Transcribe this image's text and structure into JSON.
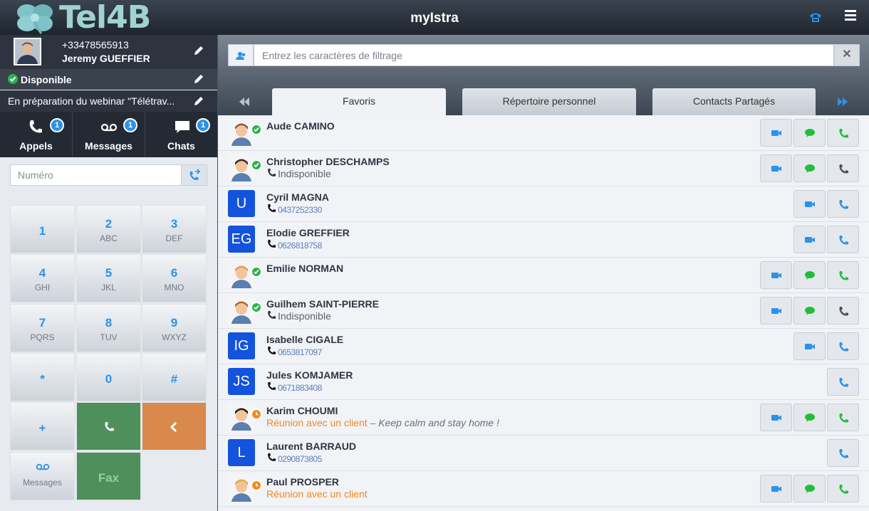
{
  "app": {
    "brand": "Tel4B",
    "title": "myIstra"
  },
  "user": {
    "number": "+33478565913",
    "name": "Jeremy GUEFFIER",
    "status": "Disponible",
    "message": "En préparation du webinar \"Télétrav..."
  },
  "nav_tabs": [
    {
      "label": "Appels",
      "badge": "1",
      "icon": "phone-icon"
    },
    {
      "label": "Messages",
      "badge": "1",
      "icon": "voicemail-icon"
    },
    {
      "label": "Chats",
      "badge": "1",
      "icon": "chat-icon"
    }
  ],
  "dialer": {
    "placeholder": "Numéro",
    "keys": [
      {
        "digit": "1",
        "letters": ""
      },
      {
        "digit": "2",
        "letters": "ABC"
      },
      {
        "digit": "3",
        "letters": "DEF"
      },
      {
        "digit": "4",
        "letters": "GHI"
      },
      {
        "digit": "5",
        "letters": "JKL"
      },
      {
        "digit": "6",
        "letters": "MNO"
      },
      {
        "digit": "7",
        "letters": "PQRS"
      },
      {
        "digit": "8",
        "letters": "TUV"
      },
      {
        "digit": "9",
        "letters": "WXYZ"
      },
      {
        "digit": "*",
        "letters": ""
      },
      {
        "digit": "0",
        "letters": ""
      },
      {
        "digit": "#",
        "letters": ""
      },
      {
        "digit": "+",
        "letters": ""
      }
    ],
    "voicemail_label": "Messages",
    "fax_label": "Fax"
  },
  "filter": {
    "placeholder": "Entrez les caractères de filtrage",
    "clear": "✕"
  },
  "contact_tabs": [
    "Favoris",
    "Répertoire personnel",
    "Contacts Partagés"
  ],
  "contacts": [
    {
      "name": "Aude CAMINO",
      "avatar": "face",
      "initials": "",
      "presence": "green",
      "sub": "",
      "sub_type": "none",
      "note": "",
      "video": true,
      "chat": true,
      "call": "green"
    },
    {
      "name": "Christopher DESCHAMPS",
      "avatar": "face",
      "initials": "",
      "presence": "green",
      "sub": "Indisponible",
      "sub_type": "phone",
      "note": "",
      "video": true,
      "chat": true,
      "call": "grey"
    },
    {
      "name": "Cyril MAGNA",
      "avatar": "init",
      "initials": "U",
      "presence": "",
      "sub": "0437252330",
      "sub_type": "number",
      "note": "",
      "video": true,
      "chat": false,
      "call": "blue"
    },
    {
      "name": "Elodie GREFFIER",
      "avatar": "init",
      "initials": "EG",
      "presence": "",
      "sub": "0626818758",
      "sub_type": "number",
      "note": "",
      "video": true,
      "chat": false,
      "call": "blue"
    },
    {
      "name": "Emilie NORMAN",
      "avatar": "face",
      "initials": "",
      "presence": "green",
      "sub": "",
      "sub_type": "none",
      "note": "",
      "video": true,
      "chat": true,
      "call": "green"
    },
    {
      "name": "Guilhem SAINT-PIERRE",
      "avatar": "face",
      "initials": "",
      "presence": "green",
      "sub": "Indisponible",
      "sub_type": "phone",
      "note": "",
      "video": true,
      "chat": true,
      "call": "grey"
    },
    {
      "name": "Isabelle CIGALE",
      "avatar": "init",
      "initials": "IG",
      "presence": "",
      "sub": "0653817097",
      "sub_type": "number",
      "note": "",
      "video": true,
      "chat": false,
      "call": "blue"
    },
    {
      "name": "Jules KOMJAMER",
      "avatar": "init",
      "initials": "JS",
      "presence": "",
      "sub": "0671883408",
      "sub_type": "number",
      "note": "",
      "video": false,
      "chat": false,
      "call": "blue"
    },
    {
      "name": "Karim CHOUMI",
      "avatar": "face",
      "initials": "",
      "presence": "orange",
      "sub": "Réunion avec un client",
      "sub_type": "orange",
      "note": " – Keep calm and stay home !",
      "video": true,
      "chat": true,
      "call": "green"
    },
    {
      "name": "Laurent BARRAUD",
      "avatar": "init",
      "initials": "L",
      "presence": "",
      "sub": "0290873805",
      "sub_type": "number",
      "note": "",
      "video": false,
      "chat": false,
      "call": "blue"
    },
    {
      "name": "Paul PROSPER",
      "avatar": "face",
      "initials": "",
      "presence": "orange",
      "sub": "Réunion avec un client",
      "sub_type": "orange",
      "note": "",
      "video": true,
      "chat": true,
      "call": "green"
    }
  ],
  "colors": {
    "accent": "#2a93e8",
    "available": "#2bb34b",
    "busy": "#f08a24",
    "initials_bg": "#1353dd"
  }
}
